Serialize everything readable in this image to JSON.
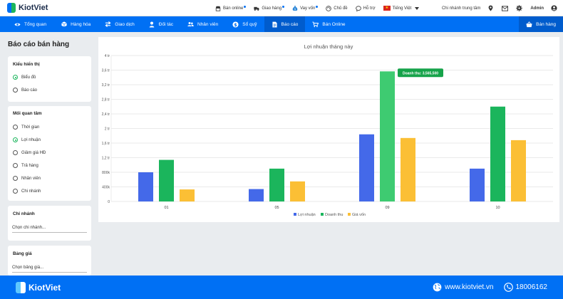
{
  "app": {
    "logo_text": "KiotViet"
  },
  "topbar": {
    "links": [
      {
        "label": "Bán online",
        "icon": "store-icon",
        "new_dot": true
      },
      {
        "label": "Giao hàng",
        "icon": "delivery-icon",
        "new_dot": true
      },
      {
        "label": "Vay vốn",
        "icon": "money-bag-icon",
        "new_dot": true
      },
      {
        "label": "Chủ đề",
        "icon": "palette-icon",
        "new_dot": false
      },
      {
        "label": "Hỗ trợ",
        "icon": "chat-icon",
        "new_dot": false
      }
    ],
    "language": "Tiếng Việt",
    "branch": "Chi nhánh trung tâm",
    "user": "Admin"
  },
  "nav": {
    "items": [
      {
        "label": "Tổng quan",
        "icon": "eye-icon"
      },
      {
        "label": "Hàng hóa",
        "icon": "box-icon"
      },
      {
        "label": "Giao dịch",
        "icon": "exchange-icon"
      },
      {
        "label": "Đối tác",
        "icon": "person-icon"
      },
      {
        "label": "Nhân viên",
        "icon": "users-icon"
      },
      {
        "label": "Sổ quỹ",
        "icon": "dollar-icon"
      },
      {
        "label": "Báo cáo",
        "icon": "report-icon"
      },
      {
        "label": "Bán Online",
        "icon": "cart-icon"
      }
    ],
    "active_index": 6,
    "sell_button": "Bán hàng"
  },
  "sidebar": {
    "page_title": "Báo cáo bán hàng",
    "display_type": {
      "title": "Kiểu hiển thị",
      "options": [
        "Biểu đồ",
        "Báo cáo"
      ],
      "selected": 0
    },
    "concern": {
      "title": "Mối quan tâm",
      "options": [
        "Thời gian",
        "Lợi nhuận",
        "Giảm giá HĐ",
        "Trả hàng",
        "Nhân viên",
        "Chi nhánh"
      ],
      "selected": 1
    },
    "branch": {
      "title": "Chi nhánh",
      "placeholder": "Chọn chi nhánh..."
    },
    "price_list": {
      "title": "Bảng giá",
      "placeholder": "Chọn bảng giá..."
    }
  },
  "chart_data": {
    "type": "bar",
    "title": "Lợi nhuận tháng này",
    "categories": [
      "01",
      "05",
      "09",
      "10"
    ],
    "series": [
      {
        "name": "Lợi nhuận",
        "color": "#4469e9",
        "values": [
          800000,
          340000,
          1840000,
          900000
        ]
      },
      {
        "name": "Doanh thu",
        "color": "#1bb55c",
        "values": [
          1140000,
          900000,
          3565500,
          2600000
        ]
      },
      {
        "name": "Giá vốn",
        "color": "#fbbf35",
        "values": [
          330000,
          550000,
          1740000,
          1680000
        ]
      }
    ],
    "ylim": [
      0,
      4000000
    ],
    "yticks": [
      "0",
      "400k",
      "800k",
      "1,2 tr",
      "1,6 tr",
      "2 tr",
      "2,4 tr",
      "2,8 tr",
      "3,2 tr",
      "3,6 tr",
      "4 tr"
    ],
    "grid": true,
    "legend": "bottom",
    "tooltip": {
      "text": "Doanh thu: 3,565,500",
      "series_index": 1,
      "category_index": 2
    }
  },
  "footer": {
    "logo_text": "KiotViet",
    "website": "www.kiotviet.vn",
    "hotline": "18006162"
  }
}
